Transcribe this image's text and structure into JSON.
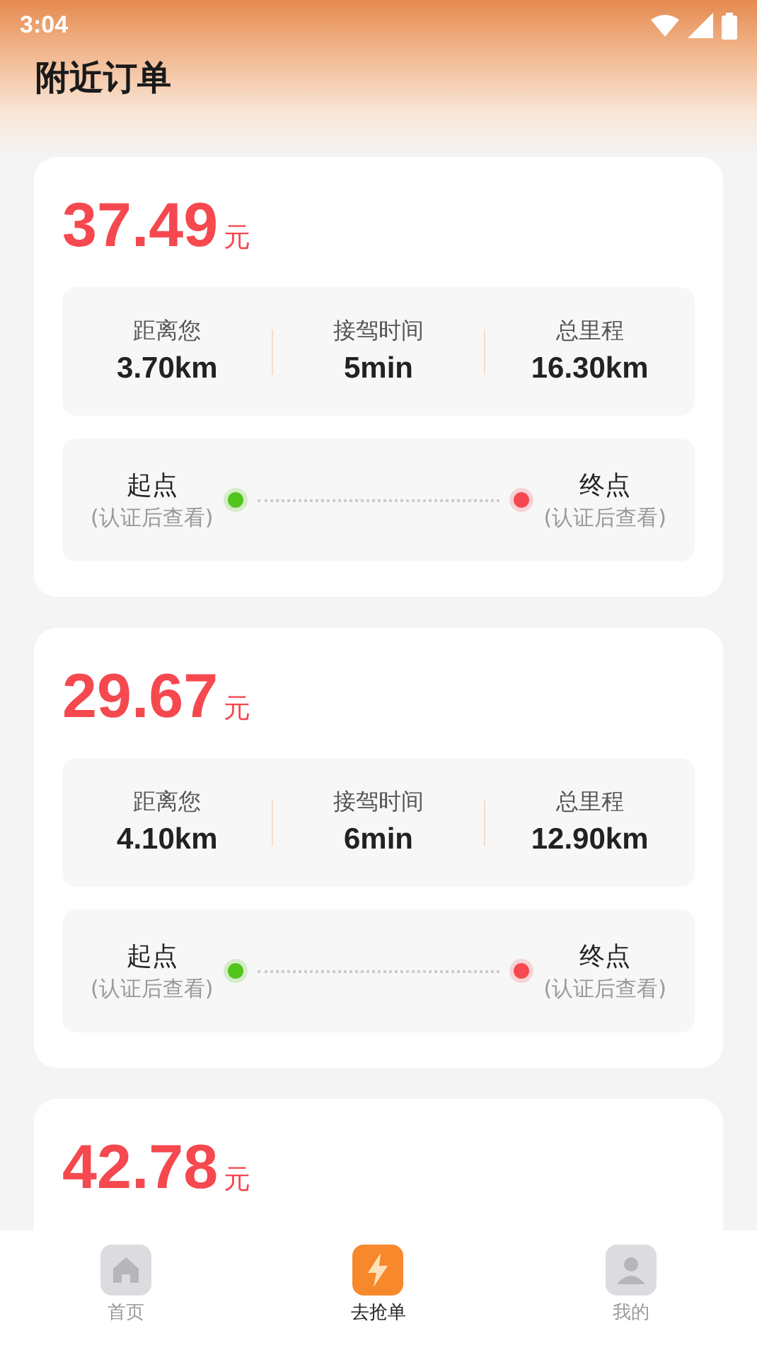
{
  "status_bar": {
    "time": "3:04"
  },
  "header": {
    "title": "附近订单"
  },
  "orders": [
    {
      "price": "37.49",
      "unit": "元",
      "stats": [
        {
          "label": "距离您",
          "value": "3.70km"
        },
        {
          "label": "接驾时间",
          "value": "5min"
        },
        {
          "label": "总里程",
          "value": "16.30km"
        }
      ],
      "route": {
        "start": {
          "label": "起点",
          "hint": "(认证后查看)",
          "color": "#52c41a"
        },
        "end": {
          "label": "终点",
          "hint": "(认证后查看)",
          "color": "#f5484f"
        }
      }
    },
    {
      "price": "29.67",
      "unit": "元",
      "stats": [
        {
          "label": "距离您",
          "value": "4.10km"
        },
        {
          "label": "接驾时间",
          "value": "6min"
        },
        {
          "label": "总里程",
          "value": "12.90km"
        }
      ],
      "route": {
        "start": {
          "label": "起点",
          "hint": "(认证后查看)",
          "color": "#52c41a"
        },
        "end": {
          "label": "终点",
          "hint": "(认证后查看)",
          "color": "#f5484f"
        }
      }
    },
    {
      "price": "42.78",
      "unit": "元"
    }
  ],
  "tab_bar": [
    {
      "kind": "home",
      "label": "首页",
      "selected": false
    },
    {
      "kind": "grab",
      "label": "去抢单",
      "selected": true
    },
    {
      "kind": "profile",
      "label": "我的",
      "selected": false
    }
  ]
}
